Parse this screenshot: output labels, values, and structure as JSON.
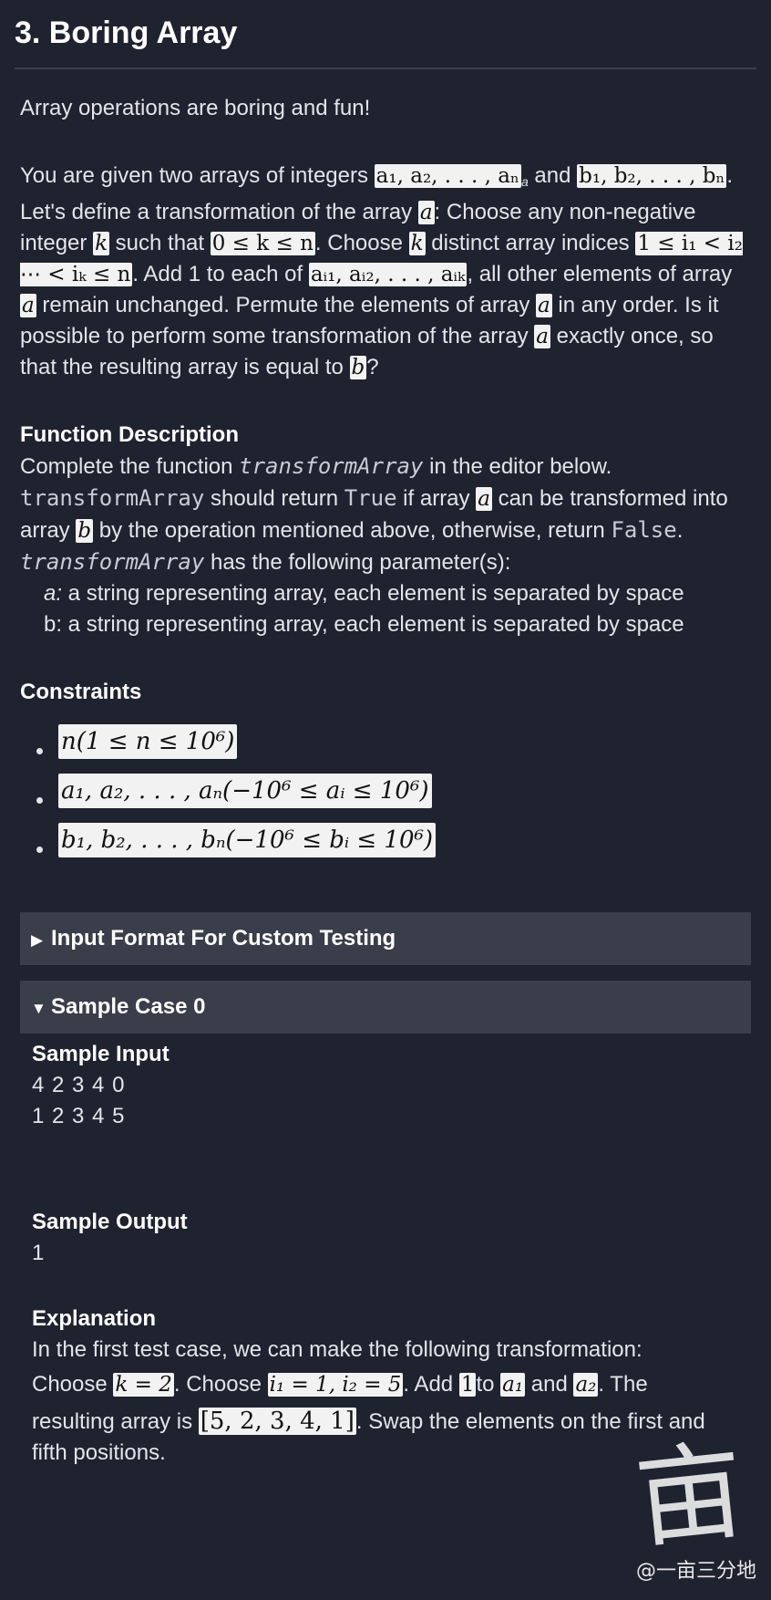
{
  "title": "3. Boring Array",
  "intro": "Array operations are boring and fun!",
  "problem": {
    "t1": "You are given two arrays of integers ",
    "m_a": "a₁, a₂, . . . , aₙ",
    "m_a_tail": "a",
    "t2": " and ",
    "m_b": "b₁, b₂, . . . , bₙ",
    "t3": ". Let's define a transformation of the array ",
    "m_a2": "a",
    "t4": ": Choose any non-negative integer ",
    "m_k": "k",
    "t5": " such that ",
    "m_range": "0 ≤ k ≤ n",
    "t6": ". Choose ",
    "m_k2": "k",
    "t7": " distinct array indices ",
    "m_idx": "1 ≤ i₁ < i₂ ⋯ < iₖ ≤ n",
    "t8": ". Add 1 to each of ",
    "m_ai": "aᵢ₁, aᵢ₂, . . . , aᵢₖ",
    "t9": ", all other elements of array ",
    "m_a3": "a",
    "t10": " remain unchanged. Permute the elements of array ",
    "m_a4": "a",
    "t11": " in any order. Is it possible to perform some transformation of the array ",
    "m_a5": "a",
    "t12": " exactly once, so that the resulting array is equal to ",
    "m_b2": "b",
    "t13": "?"
  },
  "function_description": {
    "heading": "Function Description",
    "l1_pre": "Complete the function ",
    "l1_code": "transformArray",
    "l1_post": " in the editor below.",
    "l2_code": "transformArray",
    "l2_mid": " should return ",
    "l2_true": "True",
    "l2_mid2": " if array ",
    "l2_a": "a",
    "l2_mid3": " can be transformed into array ",
    "l2_b": "b",
    "l2_mid4": " by the operation mentioned above, otherwise, return ",
    "l2_false": "False",
    "l2_end": ".",
    "l3_code": "transformArray",
    "l3_post": " has the following parameter(s):",
    "param_a_name": "a:",
    "param_a_desc": " a string representing array, each element is separated by space",
    "param_b": "b: a string representing array, each element is separated by space"
  },
  "constraints": {
    "heading": "Constraints",
    "items": [
      "n(1 ≤ n ≤ 10⁶)",
      "a₁, a₂, . . . , aₙ(−10⁶ ≤ aᵢ ≤ 10⁶)",
      "b₁, b₂, . . . , bₙ(−10⁶ ≤ bᵢ ≤ 10⁶)"
    ]
  },
  "input_format_bar": {
    "arrow": "▶",
    "label": "Input Format For Custom Testing"
  },
  "sample_case_bar": {
    "arrow": "▼",
    "label": "Sample Case 0"
  },
  "sample": {
    "input_heading": "Sample Input",
    "input_lines": [
      "4 2 3 4 0",
      "1 2 3 4 5"
    ],
    "output_heading": "Sample Output",
    "output": "1",
    "explanation_heading": "Explanation",
    "e1": "In the first test case, we can make the following transformation:",
    "e2_pre": "Choose ",
    "e2_k": "k = 2",
    "e2_mid": ". Choose ",
    "e2_i": "i₁ = 1, i₂ = 5",
    "e2_mid2": ". Add ",
    "e2_one": "1",
    "e2_mid3": "to ",
    "e2_a1": "a₁",
    "e2_and": " and ",
    "e2_a2": "a₂",
    "e2_end": ". The",
    "e3_pre": "resulting array is ",
    "e3_arr": "[5, 2, 3, 4, 1]",
    "e3_post": ". Swap the elements on the first and",
    "e4": "fifth positions."
  },
  "watermark": {
    "glyph": "亩",
    "text": "@一亩三分地"
  }
}
